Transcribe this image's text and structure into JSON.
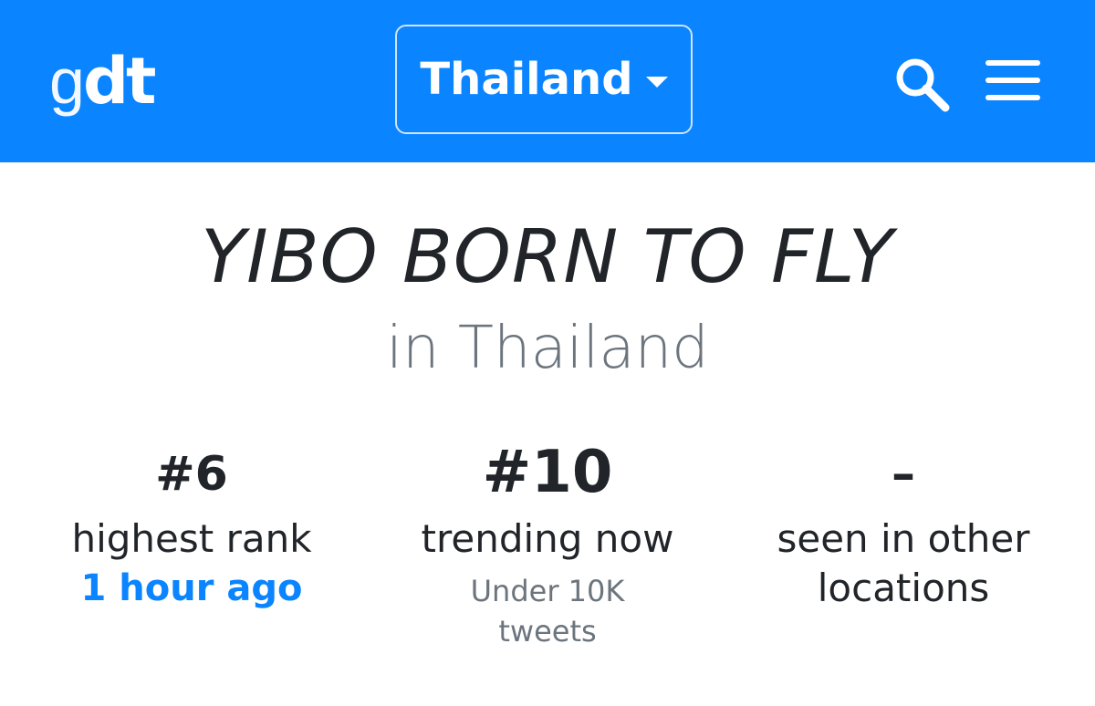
{
  "navbar": {
    "logo_light": "g",
    "logo_bold": "dt",
    "country_selector": "Thailand",
    "search_icon": "search-icon",
    "menu_icon": "hamburger-menu-icon",
    "background_color": "#0a84ff"
  },
  "trend": {
    "title": "YIBO BORN TO FLY",
    "location": "in Thailand"
  },
  "stats": {
    "highest_rank": {
      "value": "#6",
      "label": "highest rank",
      "time": "1 hour ago"
    },
    "trending_now": {
      "value": "#10",
      "label": "trending now",
      "volume": "Under 10K tweets"
    },
    "other_locations": {
      "value": "–",
      "label": "seen in other locations"
    }
  }
}
